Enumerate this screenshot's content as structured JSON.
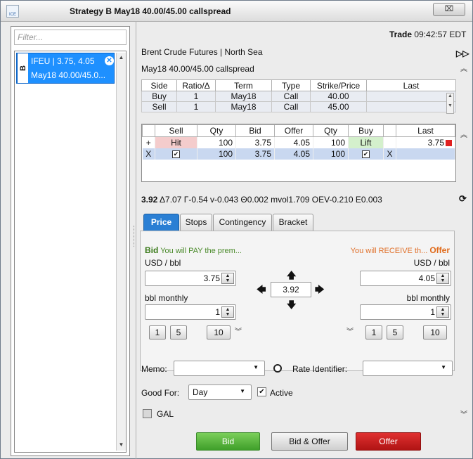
{
  "window": {
    "title": "Strategy B May18 40.00/45.00 callspread",
    "close": "⌧"
  },
  "left": {
    "filter_placeholder": "Filter...",
    "item": {
      "badge": "B",
      "line1": "IFEU | 3.75, 4.05",
      "line2": "May18 40.00/45.0..."
    }
  },
  "header": {
    "trade_label": "Trade",
    "trade_time": "09:42:57 EDT",
    "market": "Brent Crude Futures | North Sea",
    "strategy": "May18 40.00/45.00 callspread"
  },
  "legs": {
    "columns": [
      "Side",
      "Ratio/Δ",
      "Term",
      "Type",
      "Strike/Price",
      "Last"
    ],
    "rows": [
      [
        "Buy",
        "1",
        "May18",
        "Call",
        "40.00",
        ""
      ],
      [
        "Sell",
        "1",
        "May18",
        "Call",
        "45.00",
        ""
      ]
    ]
  },
  "quotes": {
    "columns": [
      "",
      "Sell",
      "Qty",
      "Bid",
      "Offer",
      "Qty",
      "Buy",
      "",
      "Last"
    ],
    "row1": {
      "marker": "+",
      "sell": "Hit",
      "qty": "100",
      "bid": "3.75",
      "offer": "4.05",
      "qty2": "100",
      "buy": "Lift",
      "last": "3.75"
    },
    "row2": {
      "marker": "X",
      "qty": "100",
      "bid": "3.75",
      "offer": "4.05",
      "qty2": "100",
      "x": "X"
    }
  },
  "greeks": {
    "mid": "3.92",
    "rest": "Δ7.07  Γ-0.54  v-0.043  Θ0.002  mvol1.709  OEV-0.210  E0.003"
  },
  "tabs": [
    "Price",
    "Stops",
    "Contingency",
    "Bracket"
  ],
  "price": {
    "bid_title": "Bid",
    "bid_note": "You will PAY the prem...",
    "offer_note": "You will RECEIVE th...",
    "offer_title": "Offer",
    "unit": "USD / bbl",
    "bid_price": "3.75",
    "offer_price": "4.05",
    "mid": "3.92",
    "qty_unit": "bbl monthly",
    "bid_qty": "1",
    "offer_qty": "1",
    "quick": [
      "1",
      "5",
      "10"
    ]
  },
  "form": {
    "memo_label": "Memo:",
    "rate_label": "Rate Identifier:",
    "goodfor_label": "Good For:",
    "goodfor_value": "Day",
    "active_label": "Active",
    "gal_label": "GAL"
  },
  "buttons": {
    "bid": "Bid",
    "bid_offer": "Bid & Offer",
    "offer": "Offer"
  },
  "colors": {
    "accent": "#2a7fd4",
    "bid": "#3f9f2a",
    "offer": "#c01c1c"
  }
}
